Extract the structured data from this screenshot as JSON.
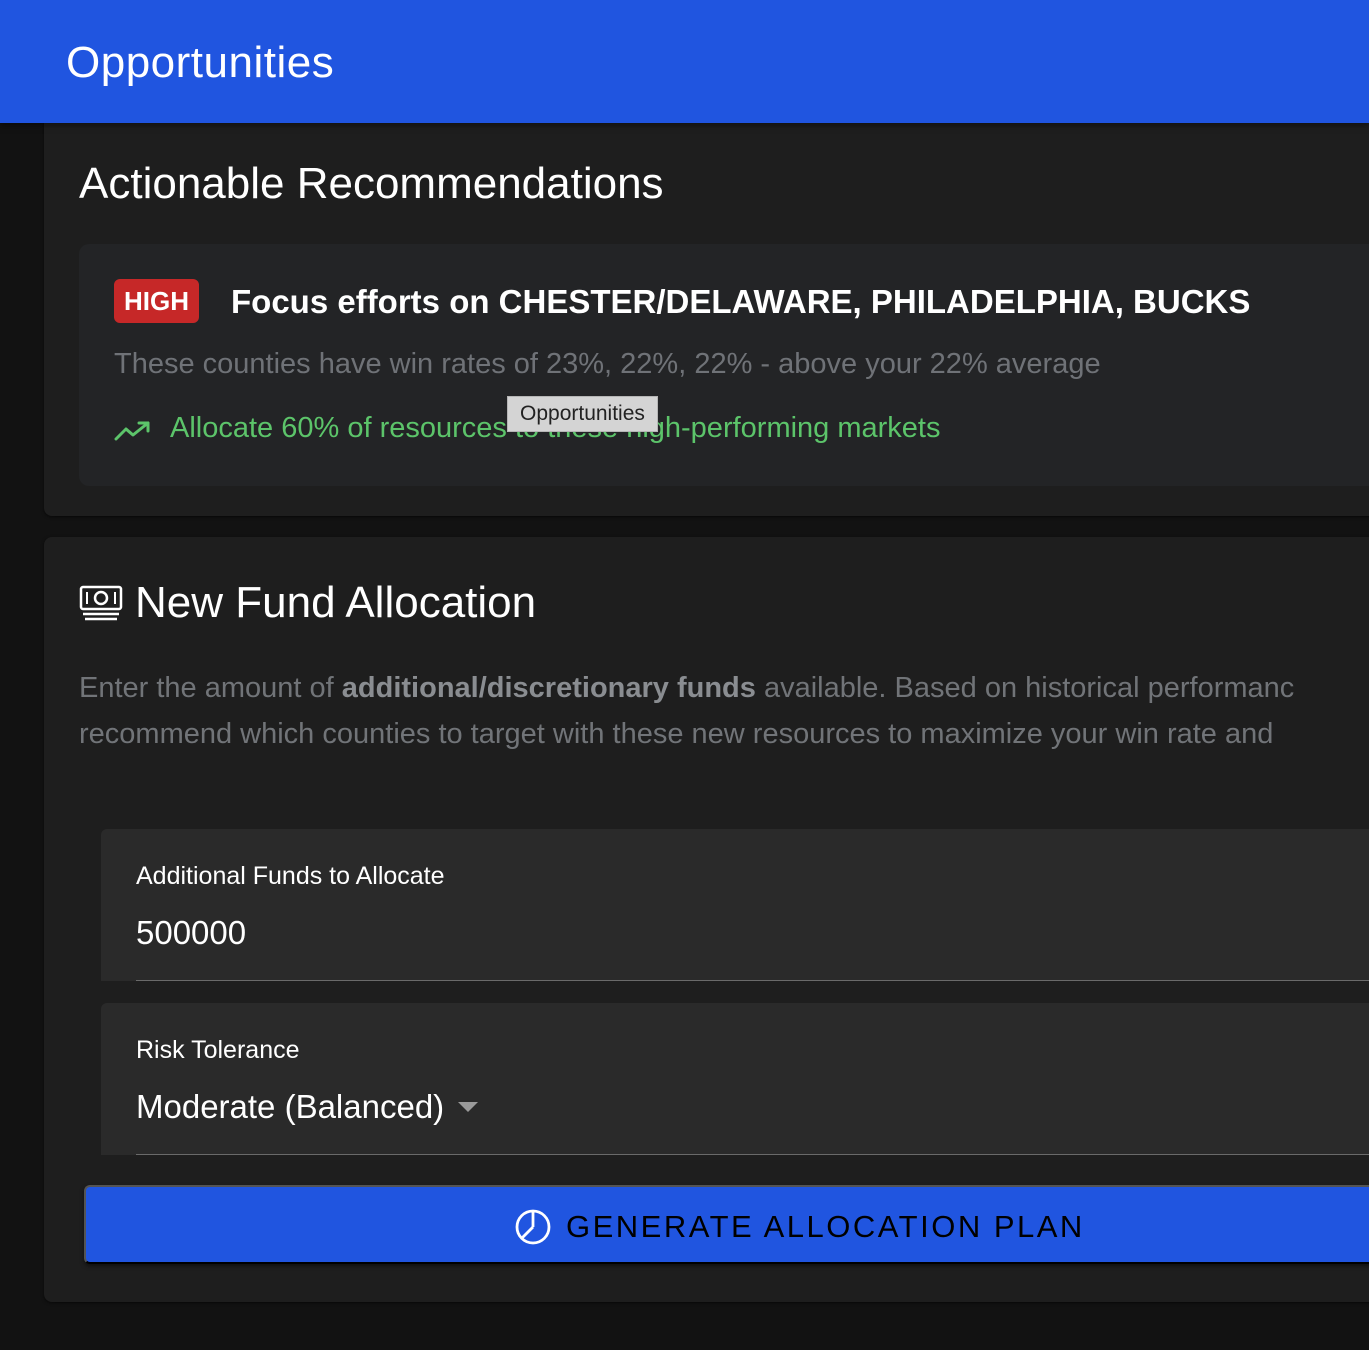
{
  "appbar": {
    "title": "Opportunities"
  },
  "tooltip": {
    "text": "Opportunities"
  },
  "recommendations": {
    "heading": "Actionable Recommendations",
    "items": [
      {
        "priority": "HIGH",
        "priority_color": "#c62828",
        "title": "Focus efforts on CHESTER/DELAWARE, PHILADELPHIA, BUCKS",
        "description": "These counties have win rates of 23%, 22%, 22% - above your 22% average",
        "action": "Allocate 60% of resources to these high-performing markets",
        "action_icon": "trending-up-icon",
        "action_color": "#5cc46a"
      }
    ]
  },
  "fund_allocation": {
    "heading": "New Fund Allocation",
    "heading_icon": "money-icon",
    "desc_prefix": "Enter the amount of ",
    "desc_bold": "additional/discretionary funds",
    "desc_suffix": " available. Based on historical performanc",
    "desc_line2": "recommend which counties to target with these new resources to maximize your win rate and",
    "amount_field": {
      "label": "Additional Funds to Allocate",
      "value": "500000"
    },
    "risk_field": {
      "label": "Risk Tolerance",
      "value": "Moderate (Balanced)"
    },
    "generate_button": {
      "label": "GENERATE ALLOCATION PLAN",
      "icon": "pie-chart-icon"
    }
  },
  "colors": {
    "primary": "#2055e0",
    "background": "#121212",
    "surface": "#1e1e1e",
    "success": "#5cc46a",
    "danger": "#c62828"
  }
}
